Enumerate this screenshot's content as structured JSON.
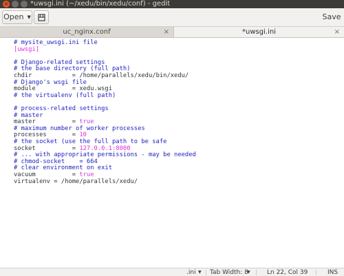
{
  "window": {
    "title": "*uwsgi.ini (~/xedu/bin/xedu/conf) - gedit"
  },
  "header": {
    "open_label": "Open",
    "save_label": "Save"
  },
  "tabs": [
    {
      "label": "uc_nginx.conf",
      "active": false
    },
    {
      "label": "*uwsgi.ini",
      "active": true
    }
  ],
  "editor": {
    "lines": [
      {
        "key": "",
        "value": "# mysite_uwsgi.ini file",
        "type": "comment"
      },
      {
        "key": "",
        "value": "[uwsgi]",
        "type": "section"
      },
      {
        "key": "",
        "value": "",
        "type": "blank"
      },
      {
        "key": "",
        "value": "# Django-related settings",
        "type": "comment"
      },
      {
        "key": "",
        "value": "# the base directory (full path)",
        "type": "comment"
      },
      {
        "key": "chdir           = ",
        "value": "/home/parallels/xedu/bin/xedu/",
        "type": "kv"
      },
      {
        "key": "",
        "value": "# Django's wsgi file",
        "type": "comment"
      },
      {
        "key": "module          = ",
        "value": "xedu.wsgi",
        "type": "kv"
      },
      {
        "key": "",
        "value": "# the virtualenv (full path)",
        "type": "comment"
      },
      {
        "key": "",
        "value": "",
        "type": "blank"
      },
      {
        "key": "",
        "value": "# process-related settings",
        "type": "comment"
      },
      {
        "key": "",
        "value": "# master",
        "type": "comment"
      },
      {
        "key": "master          = ",
        "value": "true",
        "type": "bool"
      },
      {
        "key": "",
        "value": "# maximum number of worker processes",
        "type": "comment"
      },
      {
        "key": "processes       = ",
        "value": "10",
        "type": "num"
      },
      {
        "key": "",
        "value": "# the socket (use the full path to be safe",
        "type": "comment"
      },
      {
        "key": "socket          = ",
        "value": "127.0.0.1:8000",
        "type": "num"
      },
      {
        "key": "",
        "value": "# ... with appropriate permissions - may be needed",
        "type": "comment"
      },
      {
        "key": "",
        "value": "# chmod-socket    = 664",
        "type": "comment"
      },
      {
        "key": "",
        "value": "# clear environment on exit",
        "type": "comment"
      },
      {
        "key": "vacuum          = ",
        "value": "true",
        "type": "bool"
      },
      {
        "key": "virtualenv = ",
        "value": "/home/parallels/xedu/",
        "type": "kv"
      }
    ]
  },
  "status": {
    "language": ".ini",
    "tab_width": "Tab Width: 8",
    "position": "Ln 22, Col 39",
    "mode": "INS"
  },
  "colors": {
    "comment": "#1c1fbd",
    "section": "#e02dd6",
    "value_literal": "#cf3ddb",
    "titlebar": "#3c3b37",
    "close_button": "#e95420"
  },
  "icons": {
    "new_document": "new-document-icon",
    "dropdown": "chevron-down-icon",
    "close": "close-icon"
  }
}
